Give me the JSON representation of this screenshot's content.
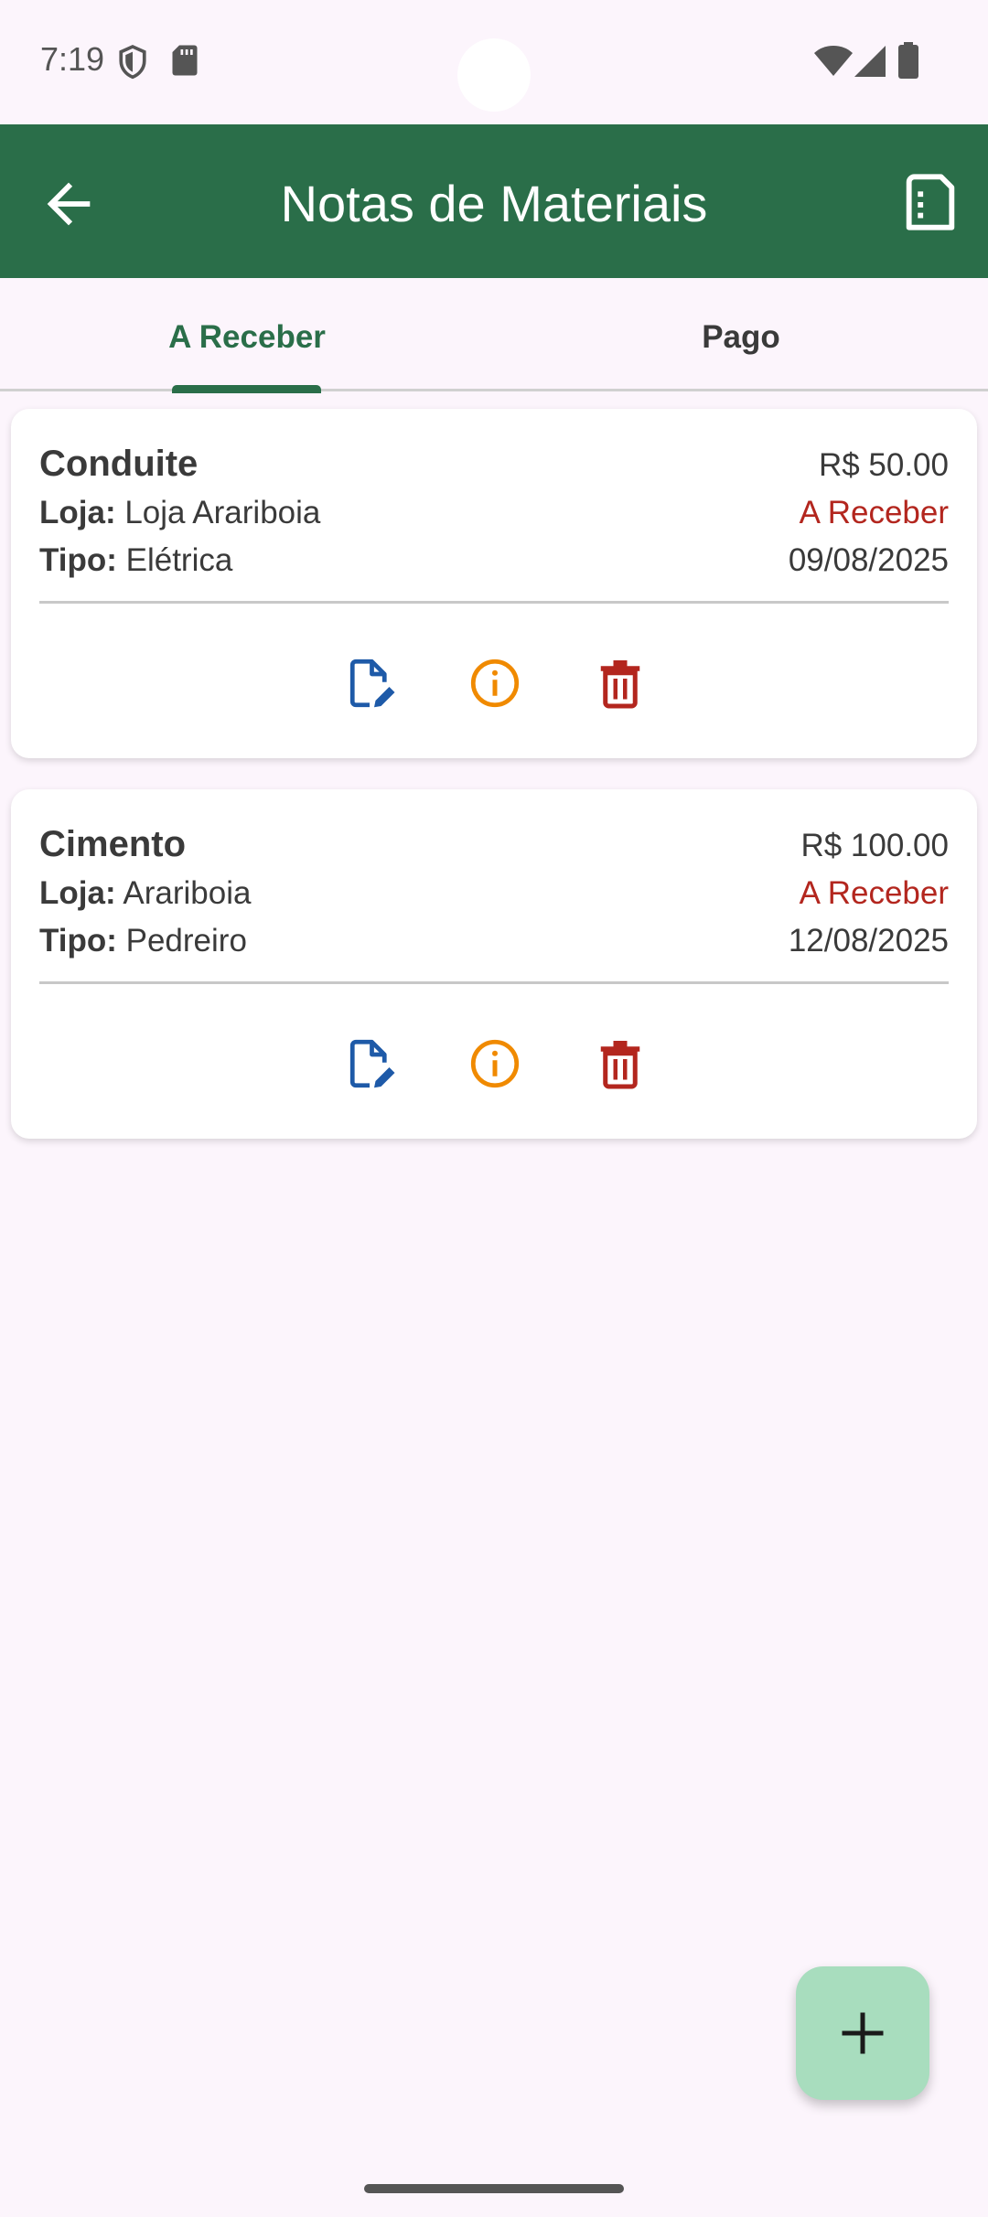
{
  "status_bar": {
    "time": "7:19",
    "icons": [
      "shield-icon",
      "sd-card-icon",
      "wifi-icon",
      "signal-icon",
      "battery-icon"
    ]
  },
  "app_bar": {
    "title": "Notas de Materiais",
    "back_icon": "arrow-back-icon",
    "action_icon": "report-icon",
    "color": "#2A6E49"
  },
  "tabs": [
    {
      "label": "A Receber",
      "active": true
    },
    {
      "label": "Pago",
      "active": false
    }
  ],
  "cards": [
    {
      "name": "Conduite",
      "value": "R$ 50.00",
      "store_label": "Loja:",
      "store": "Loja Arariboia",
      "type_label": "Tipo:",
      "type": "Elétrica",
      "status": "A Receber",
      "date": "09/08/2025"
    },
    {
      "name": "Cimento",
      "value": "R$ 100.00",
      "store_label": "Loja:",
      "store": "Arariboia",
      "type_label": "Tipo:",
      "type": "Pedreiro",
      "status": "A Receber",
      "date": "12/08/2025"
    }
  ],
  "card_actions": [
    "edit-note-icon",
    "info-icon",
    "delete-icon"
  ],
  "fab": {
    "icon": "plus-icon",
    "color": "#A8DDBE"
  },
  "colors": {
    "primary": "#2A6E49",
    "status_pending": "#B3261E",
    "edit": "#1E5AA8",
    "info": "#F08A00",
    "delete": "#B3261E",
    "background": "#FCF5FC"
  }
}
